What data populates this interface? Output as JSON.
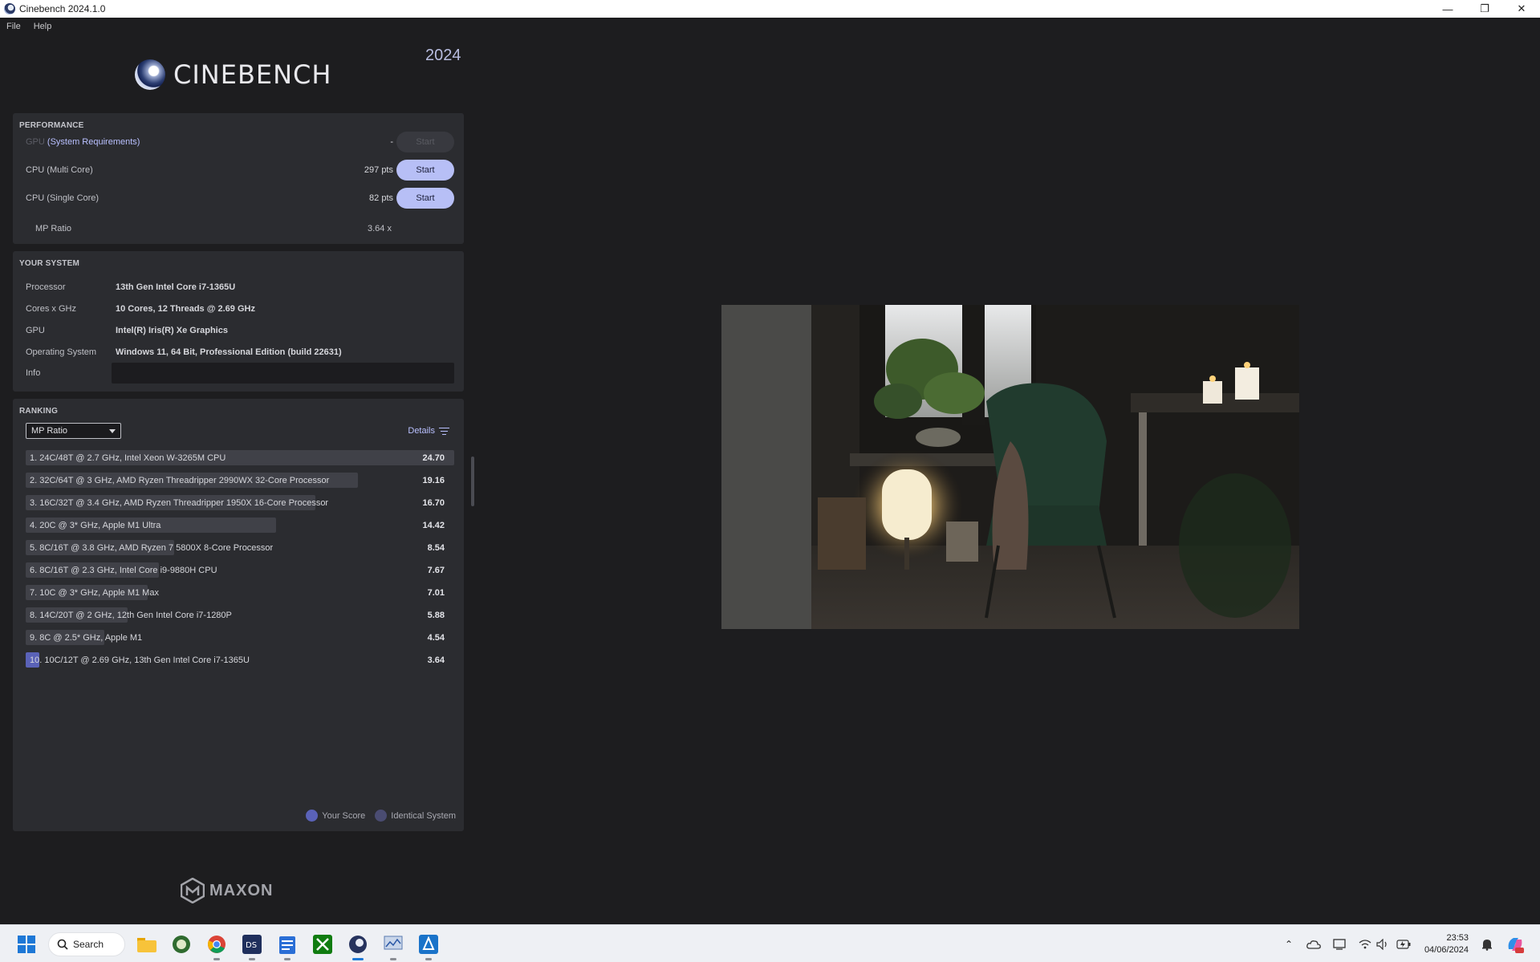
{
  "window": {
    "title": "Cinebench 2024.1.0"
  },
  "menu": [
    "File",
    "Help"
  ],
  "brand": {
    "logo_text": "CINEBENCH",
    "year": "2024",
    "footer_logo": "MAXON"
  },
  "performance": {
    "title": "PERFORMANCE",
    "gpu": {
      "label_dim": "GPU",
      "link": "(System Requirements)",
      "score": "-",
      "button": "Start"
    },
    "multi": {
      "label": "CPU (Multi Core)",
      "score": "297 pts",
      "button": "Start"
    },
    "single": {
      "label": "CPU (Single Core)",
      "score": "82 pts",
      "button": "Start"
    },
    "mp_ratio": {
      "label": "MP Ratio",
      "value": "3.64 x"
    }
  },
  "system": {
    "title": "YOUR SYSTEM",
    "rows": [
      {
        "key": "Processor",
        "value": "13th Gen Intel Core i7-1365U"
      },
      {
        "key": "Cores x GHz",
        "value": "10 Cores, 12 Threads @ 2.69 GHz"
      },
      {
        "key": "GPU",
        "value": "Intel(R) Iris(R) Xe Graphics"
      },
      {
        "key": "Operating System",
        "value": "Windows 11, 64 Bit, Professional Edition (build 22631)"
      },
      {
        "key": "Info",
        "value": ""
      }
    ]
  },
  "ranking": {
    "title": "RANKING",
    "dropdown_value": "MP Ratio",
    "details_label": "Details",
    "max_score": 24.7,
    "entries": [
      {
        "label": "1. 24C/48T @ 2.7 GHz, Intel Xeon W-3265M CPU",
        "score": "24.70",
        "value": 24.7,
        "mine": false
      },
      {
        "label": "2. 32C/64T @ 3 GHz, AMD Ryzen Threadripper 2990WX 32-Core Processor",
        "score": "19.16",
        "value": 19.16,
        "mine": false
      },
      {
        "label": "3. 16C/32T @ 3.4 GHz, AMD Ryzen Threadripper 1950X 16-Core Processor",
        "score": "16.70",
        "value": 16.7,
        "mine": false
      },
      {
        "label": "4. 20C @ 3* GHz, Apple M1 Ultra",
        "score": "14.42",
        "value": 14.42,
        "mine": false
      },
      {
        "label": "5. 8C/16T @ 3.8 GHz, AMD Ryzen 7 5800X 8-Core Processor",
        "score": "8.54",
        "value": 8.54,
        "mine": false
      },
      {
        "label": "6. 8C/16T @ 2.3 GHz, Intel Core i9-9880H CPU",
        "score": "7.67",
        "value": 7.67,
        "mine": false
      },
      {
        "label": "7. 10C @ 3* GHz, Apple M1 Max",
        "score": "7.01",
        "value": 7.01,
        "mine": false
      },
      {
        "label": "8. 14C/20T @ 2 GHz, 12th Gen Intel Core i7-1280P",
        "score": "5.88",
        "value": 5.88,
        "mine": false
      },
      {
        "label": "9. 8C @ 2.5* GHz, Apple M1",
        "score": "4.54",
        "value": 4.54,
        "mine": false
      },
      {
        "label": "10. 10C/12T @ 2.69 GHz, 13th Gen Intel Core i7-1365U",
        "score": "3.64",
        "value": 3.64,
        "mine": true
      }
    ],
    "legend": [
      {
        "label": "Your Score",
        "color": "#5a62b8"
      },
      {
        "label": "Identical System",
        "color": "#4a4c72"
      }
    ]
  },
  "colors": {
    "accent": "#b7bff6",
    "panel": "#2b2c30",
    "background": "#1d1d1f",
    "my_bar": "#5a62b8"
  },
  "taskbar": {
    "search_label": "Search",
    "apps": [
      "start-icon",
      "file-explorer-icon",
      "vuescan-icon",
      "chrome-icon",
      "ds-icon",
      "notepad-icon",
      "xbox-icon",
      "cinebench-icon",
      "monitor-app-icon",
      "flutter-app-icon"
    ],
    "time": "23:53",
    "date": "04/06/2024"
  }
}
